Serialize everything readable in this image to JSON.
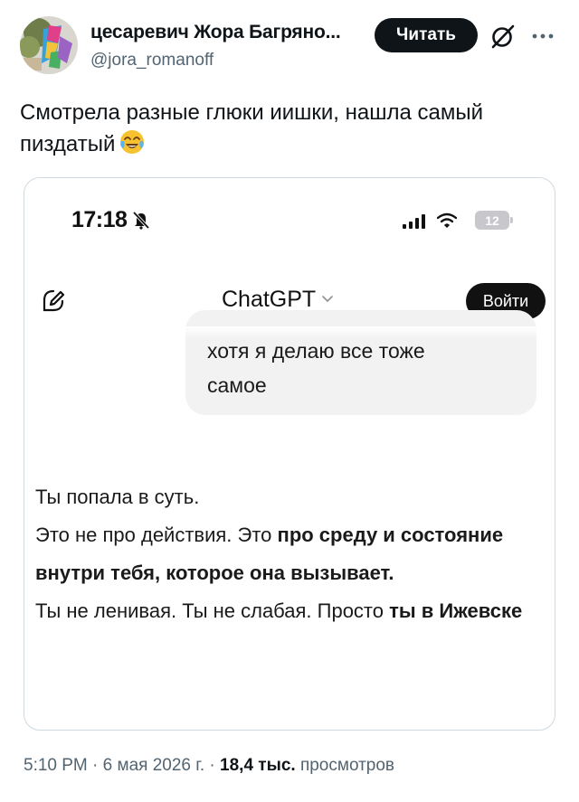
{
  "author": {
    "name": "цесаревич Жора Багряно...",
    "handle": "@jora_romanoff",
    "follow_label": "Читать"
  },
  "tweet": {
    "text": "Смотрела разные глюки иишки, нашла самый пиздатый",
    "emoji": "face-with-tears-of-joy"
  },
  "screenshot": {
    "status_bar": {
      "time": "17:18",
      "battery": "12"
    },
    "app_bar": {
      "title": "ChatGPT",
      "login_label": "Войти"
    },
    "user_message": {
      "line1": "хотя я делаю все тоже",
      "line2": "самое"
    },
    "assistant_message": {
      "p1": "Ты попала в суть.",
      "p2_plain": "Это не про действия. Это ",
      "p2_bold": "про среду и состояние внутри тебя, которое она вызывает.",
      "p3_plain": "Ты не ленивая. Ты не слабая. Просто ",
      "p3_bold": "ты в Ижевске"
    }
  },
  "meta": {
    "time": "5:10 PM",
    "date": "6 мая 2026 г.",
    "views_count": "18,4 тыс.",
    "views_label": "просмотров",
    "separator": "·"
  },
  "colors": {
    "text": "#0f1419",
    "secondary": "#536471",
    "border": "#cfd9de",
    "bubble": "#f2f2f2",
    "button": "#0f1419"
  }
}
